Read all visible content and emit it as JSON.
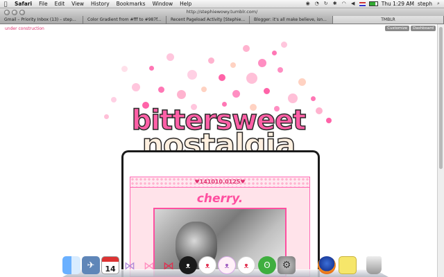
{
  "menubar": {
    "app": "Safari",
    "items": [
      "File",
      "Edit",
      "View",
      "History",
      "Bookmarks",
      "Window",
      "Help"
    ],
    "clock": "Thu 1:29 AM",
    "user": "steph"
  },
  "window": {
    "url": "http://stephiewowy.tumblr.com/"
  },
  "tabs": [
    "Gmail – Priority Inbox (13) – step...",
    "Color Gradient from #fff to #987f...",
    "Recent Pageload Activity [Stephie...",
    "Blogger: it's all make believe, isn...",
    "TMBLR"
  ],
  "page": {
    "construction": "under construction",
    "customize": "Customize",
    "dashboard": "Dashboard",
    "logo_line1": "bittersweet",
    "logo_line2": "nostalgia",
    "post_date": "♥141010.0125♥",
    "post_title": "cherry."
  },
  "dock": {
    "calendar_day": "14",
    "icons": [
      "finder-icon",
      "preview-icon",
      "ical-icon",
      "bow-icon",
      "bow-icon",
      "bow-icon",
      "hello-kitty-icon",
      "hello-kitty-icon",
      "hello-kitty-icon",
      "hello-kitty-icon",
      "keroppi-icon",
      "system-preferences-icon",
      "firefox-icon",
      "stickies-icon",
      "trash-icon"
    ]
  },
  "colors": {
    "accent_pink": "#ff4fa0",
    "construction_pink": "#e0306f"
  }
}
